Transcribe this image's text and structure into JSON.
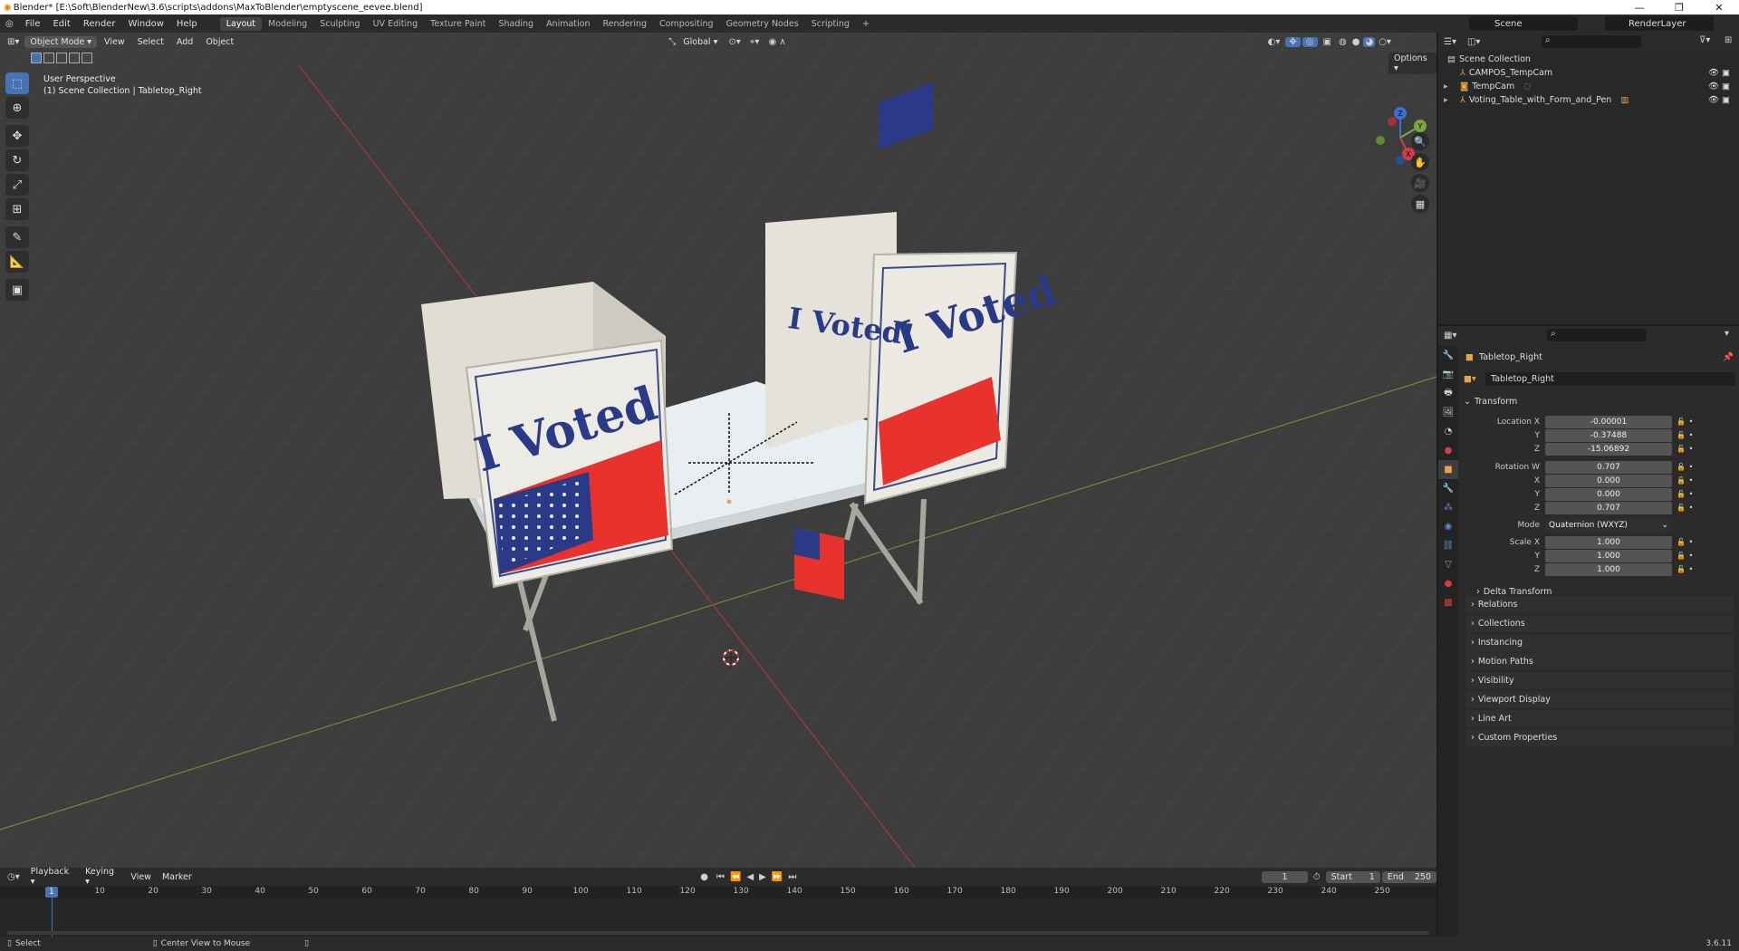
{
  "window": {
    "title": "Blender* [E:\\Soft\\BlenderNew\\3.6\\scripts\\addons\\MaxToBlender\\emptyscene_eevee.blend]"
  },
  "menus": [
    "File",
    "Edit",
    "Render",
    "Window",
    "Help"
  ],
  "workspaces": [
    "Layout",
    "Modeling",
    "Sculpting",
    "UV Editing",
    "Texture Paint",
    "Shading",
    "Animation",
    "Rendering",
    "Compositing",
    "Geometry Nodes",
    "Scripting"
  ],
  "scene": {
    "name": "Scene",
    "render_layer": "RenderLayer"
  },
  "viewport": {
    "mode": "Object Mode",
    "menus": [
      "View",
      "Select",
      "Add",
      "Object"
    ],
    "orientation": "Global",
    "options_label": "Options",
    "perspective_label": "User Perspective",
    "context_label": "(1) Scene Collection | Tabletop_Right",
    "gizmo_axes": [
      "Z",
      "Y",
      "X"
    ]
  },
  "scene_art": {
    "left_sign_text": "I Voted",
    "back_sign_text": "I Voted!",
    "right_sign_text": "I Voted"
  },
  "outliner": {
    "root": "Scene Collection",
    "items": [
      "CAMPOS_TempCam",
      "TempCam",
      "Voting_Table_with_Form_and_Pen"
    ]
  },
  "properties": {
    "object_name": "Tabletop_Right",
    "data_name": "Tabletop_Right",
    "transform_label": "Transform",
    "location_label": "Location X",
    "location": [
      "-0.00001",
      "-0.37488",
      "-15.06892"
    ],
    "rotation_label": "Rotation W",
    "rotation": [
      "0.707",
      "0.000",
      "0.000",
      "0.707"
    ],
    "axis_labels": [
      "X",
      "Y",
      "Z"
    ],
    "mode_label": "Mode",
    "mode_value": "Quaternion (WXYZ)",
    "scale_label": "Scale X",
    "scale": [
      "1.000",
      "1.000",
      "1.000"
    ],
    "delta_transform": "Delta Transform",
    "panels": [
      "Relations",
      "Collections",
      "Instancing",
      "Motion Paths",
      "Visibility",
      "Viewport Display",
      "Line Art",
      "Custom Properties"
    ]
  },
  "timeline": {
    "menus": [
      "Playback",
      "Keying",
      "View",
      "Marker"
    ],
    "current_frame": "1",
    "start_label": "Start",
    "start": "1",
    "end_label": "End",
    "end": "250",
    "ruler_start": "1",
    "ruler_labels": [
      "10",
      "20",
      "30",
      "40",
      "50",
      "60",
      "70",
      "80",
      "90",
      "100",
      "110",
      "120",
      "130",
      "140",
      "150",
      "160",
      "170",
      "180",
      "190",
      "200",
      "210",
      "220",
      "230",
      "240",
      "250"
    ]
  },
  "statusbar": {
    "left": "Select",
    "middle": "Center View to Mouse",
    "version": "3.6.11"
  }
}
